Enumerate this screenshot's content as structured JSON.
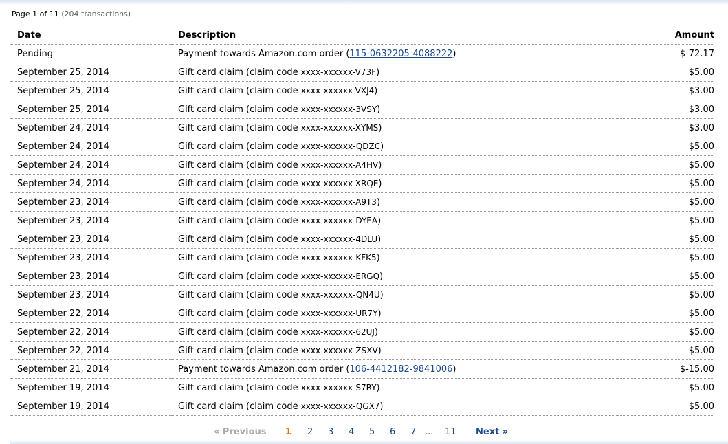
{
  "summary": {
    "page_text": "Page 1 of 11",
    "count_text": "(204 transactions)"
  },
  "table": {
    "headers": {
      "date": "Date",
      "description": "Description",
      "amount": "Amount"
    },
    "rows": [
      {
        "date": "Pending",
        "type": "payment",
        "prefix": "Payment towards Amazon.com order (",
        "link": "115-0632205-4088222",
        "suffix": ")",
        "amount": "$-72.17"
      },
      {
        "date": "September 25, 2014",
        "type": "claim",
        "prefix": "Gift card claim (claim code ",
        "code": "xxxx-xxxxxx-V73F",
        "suffix": ")",
        "amount": "$5.00"
      },
      {
        "date": "September 25, 2014",
        "type": "claim",
        "prefix": "Gift card claim (claim code ",
        "code": "xxxx-xxxxxx-VXJ4",
        "suffix": ")",
        "amount": "$3.00"
      },
      {
        "date": "September 25, 2014",
        "type": "claim",
        "prefix": "Gift card claim (claim code ",
        "code": "xxxx-xxxxxx-3VSY",
        "suffix": ")",
        "amount": "$3.00"
      },
      {
        "date": "September 24, 2014",
        "type": "claim",
        "prefix": "Gift card claim (claim code ",
        "code": "xxxx-xxxxxx-XYMS",
        "suffix": ")",
        "amount": "$3.00"
      },
      {
        "date": "September 24, 2014",
        "type": "claim",
        "prefix": "Gift card claim (claim code ",
        "code": "xxxx-xxxxxx-QDZC",
        "suffix": ")",
        "amount": "$5.00"
      },
      {
        "date": "September 24, 2014",
        "type": "claim",
        "prefix": "Gift card claim (claim code ",
        "code": "xxxx-xxxxxx-A4HV",
        "suffix": ")",
        "amount": "$5.00"
      },
      {
        "date": "September 24, 2014",
        "type": "claim",
        "prefix": "Gift card claim (claim code ",
        "code": "xxxx-xxxxxx-XRQE",
        "suffix": ")",
        "amount": "$5.00"
      },
      {
        "date": "September 23, 2014",
        "type": "claim",
        "prefix": "Gift card claim (claim code ",
        "code": "xxxx-xxxxxx-A9T3",
        "suffix": ")",
        "amount": "$5.00"
      },
      {
        "date": "September 23, 2014",
        "type": "claim",
        "prefix": "Gift card claim (claim code ",
        "code": "xxxx-xxxxxx-DYEA",
        "suffix": ")",
        "amount": "$5.00"
      },
      {
        "date": "September 23, 2014",
        "type": "claim",
        "prefix": "Gift card claim (claim code ",
        "code": "xxxx-xxxxxx-4DLU",
        "suffix": ")",
        "amount": "$5.00"
      },
      {
        "date": "September 23, 2014",
        "type": "claim",
        "prefix": "Gift card claim (claim code ",
        "code": "xxxx-xxxxxx-KFK5",
        "suffix": ")",
        "amount": "$5.00"
      },
      {
        "date": "September 23, 2014",
        "type": "claim",
        "prefix": "Gift card claim (claim code ",
        "code": "xxxx-xxxxxx-ERGQ",
        "suffix": ")",
        "amount": "$5.00"
      },
      {
        "date": "September 23, 2014",
        "type": "claim",
        "prefix": "Gift card claim (claim code ",
        "code": "xxxx-xxxxxx-QN4U",
        "suffix": ")",
        "amount": "$5.00"
      },
      {
        "date": "September 22, 2014",
        "type": "claim",
        "prefix": "Gift card claim (claim code ",
        "code": "xxxx-xxxxxx-UR7Y",
        "suffix": ")",
        "amount": "$5.00"
      },
      {
        "date": "September 22, 2014",
        "type": "claim",
        "prefix": "Gift card claim (claim code ",
        "code": "xxxx-xxxxxx-62UJ",
        "suffix": ")",
        "amount": "$5.00"
      },
      {
        "date": "September 22, 2014",
        "type": "claim",
        "prefix": "Gift card claim (claim code ",
        "code": "xxxx-xxxxxx-ZSXV",
        "suffix": ")",
        "amount": "$5.00"
      },
      {
        "date": "September 21, 2014",
        "type": "payment",
        "prefix": "Payment towards Amazon.com order (",
        "link": "106-4412182-9841006",
        "suffix": ")",
        "amount": "$-15.00"
      },
      {
        "date": "September 19, 2014",
        "type": "claim",
        "prefix": "Gift card claim (claim code ",
        "code": "xxxx-xxxxxx-S7RY",
        "suffix": ")",
        "amount": "$5.00"
      },
      {
        "date": "September 19, 2014",
        "type": "claim",
        "prefix": "Gift card claim (claim code ",
        "code": "xxxx-xxxxxx-QGX7",
        "suffix": ")",
        "amount": "$5.00"
      }
    ]
  },
  "pagination": {
    "previous_label": "« Previous",
    "pages": [
      "1",
      "2",
      "3",
      "4",
      "5",
      "6",
      "7"
    ],
    "ellipsis": "...",
    "last_page": "11",
    "next_label": "Next »",
    "current_page": "1"
  },
  "colors": {
    "link": "#1a4a8c",
    "current_page": "#e47911",
    "disabled": "#aaaaaa"
  }
}
